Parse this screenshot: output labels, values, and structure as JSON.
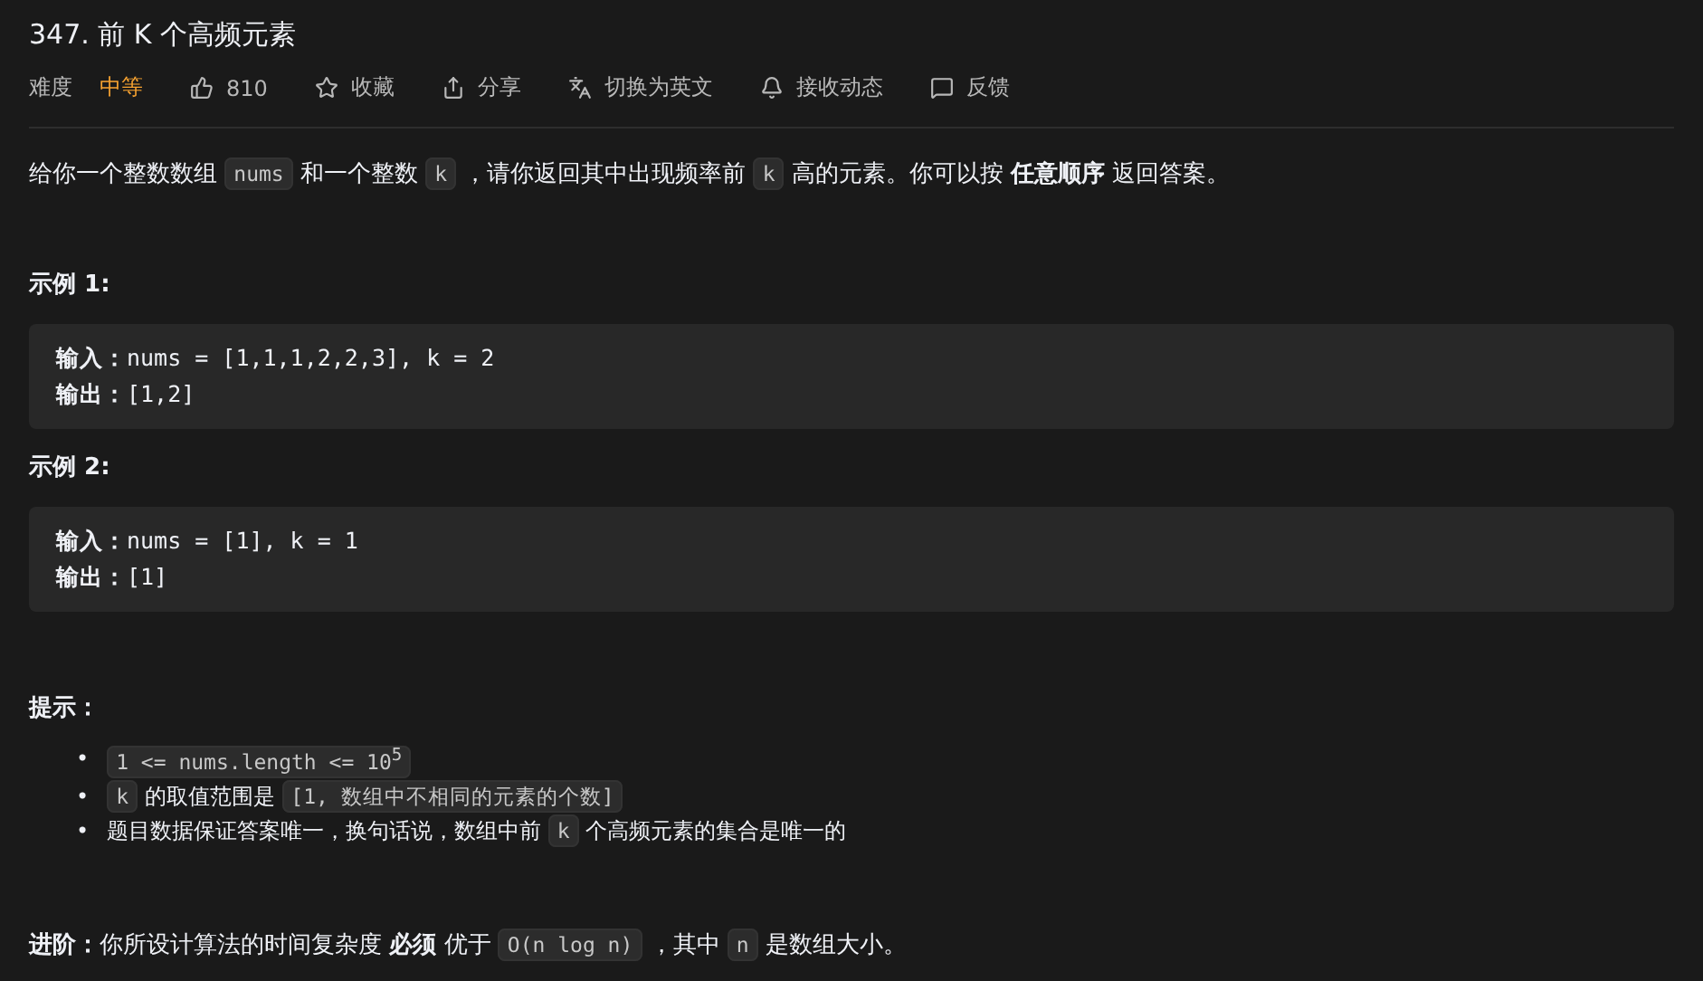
{
  "title": "347. 前 K 个高频元素",
  "meta": [
    {
      "kind": "difficulty",
      "label": "难度",
      "value": "中等"
    },
    {
      "kind": "like",
      "label": "810"
    },
    {
      "kind": "star",
      "label": "收藏"
    },
    {
      "kind": "share",
      "label": "分享"
    },
    {
      "kind": "translate",
      "label": "切换为英文"
    },
    {
      "kind": "bell",
      "label": "接收动态"
    },
    {
      "kind": "feedback",
      "label": "反馈"
    }
  ],
  "description": [
    {
      "kind": "text",
      "text": "给你一个整数数组 "
    },
    {
      "kind": "code",
      "text": "nums"
    },
    {
      "kind": "text",
      "text": " 和一个整数 "
    },
    {
      "kind": "code",
      "text": "k"
    },
    {
      "kind": "text",
      "text": " ，请你返回其中出现频率前 "
    },
    {
      "kind": "code",
      "text": "k"
    },
    {
      "kind": "text",
      "text": " 高的元素。你可以按 "
    },
    {
      "kind": "bold",
      "text": "任意顺序"
    },
    {
      "kind": "text",
      "text": " 返回答案。"
    }
  ],
  "examples": [
    {
      "heading": "示例 1:",
      "lines": [
        {
          "label": "输入：",
          "value": "nums = [1,1,1,2,2,3], k = 2"
        },
        {
          "label": "输出：",
          "value": "[1,2]"
        }
      ]
    },
    {
      "heading": "示例 2:",
      "lines": [
        {
          "label": "输入：",
          "value": "nums = [1], k = 1"
        },
        {
          "label": "输出：",
          "value": "[1]"
        }
      ]
    }
  ],
  "hints_heading": "提示：",
  "hints": [
    {
      "marker": "•",
      "segments": [
        {
          "kind": "code",
          "text": "1 <= nums.length <= 10$^{5}$"
        }
      ]
    },
    {
      "marker": "•",
      "segments": [
        {
          "kind": "code",
          "text": "k"
        },
        {
          "kind": "text",
          "text": " 的取值范围是 "
        },
        {
          "kind": "code",
          "text": "[1, 数组中不相同的元素的个数]"
        }
      ]
    },
    {
      "marker": "•",
      "segments": [
        {
          "kind": "text",
          "text": "题目数据保证答案唯一，换句话说，数组中前 "
        },
        {
          "kind": "code",
          "text": "k"
        },
        {
          "kind": "text",
          "text": " 个高频元素的集合是唯一的"
        }
      ]
    }
  ],
  "followup": [
    {
      "kind": "bold",
      "text": "进阶："
    },
    {
      "kind": "text",
      "text": "你所设计算法的时间复杂度 "
    },
    {
      "kind": "bold",
      "text": "必须"
    },
    {
      "kind": "text",
      "text": " 优于 "
    },
    {
      "kind": "code",
      "text": "O(n log n)"
    },
    {
      "kind": "text",
      "text": " ，其中 "
    },
    {
      "kind": "code",
      "text": "n"
    },
    {
      "kind": "text",
      "text": " 是数组大小。"
    }
  ]
}
